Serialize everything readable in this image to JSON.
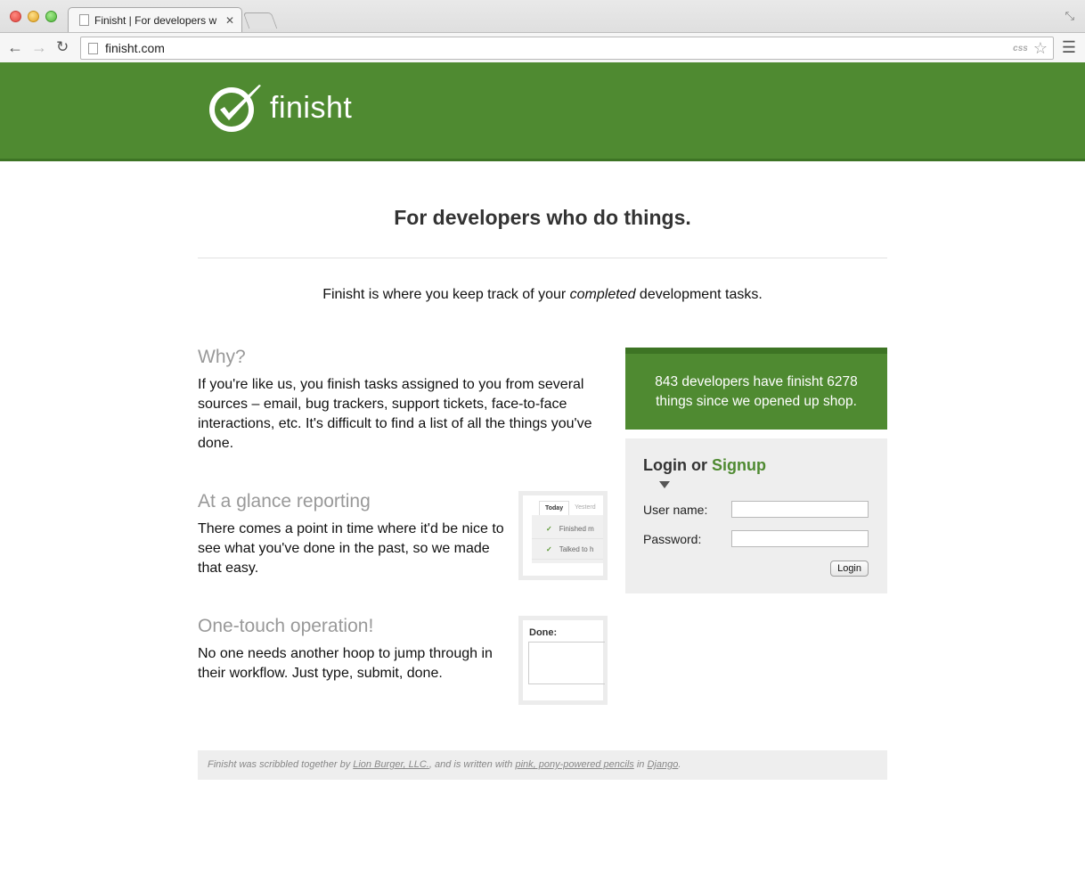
{
  "browser": {
    "tab_title": "Finisht | For developers w",
    "tab_close": "✕",
    "url": "finisht.com",
    "css_badge": "css",
    "icons": [
      "back-icon",
      "forward-icon",
      "reload-icon",
      "star-icon",
      "menu-icon",
      "fullscreen-icon"
    ]
  },
  "header": {
    "logo_text": "finisht",
    "brand_color": "#4f8a31"
  },
  "main": {
    "headline": "For developers who do things.",
    "tagline_before": "Finisht is where you keep track of your ",
    "tagline_em": "completed",
    "tagline_after": " development tasks."
  },
  "features": [
    {
      "title": "Why?",
      "text": "If you're like us, you finish tasks assigned to you from several sources – email, bug trackers, support tickets, face-to-face interactions, etc. It's difficult to find a list of all the things you've done."
    },
    {
      "title": "At a glance reporting",
      "text": "There comes a point in time where it'd be nice to see what you've done in the past, so we made that easy."
    },
    {
      "title": "One-touch operation!",
      "text": "No one needs another hoop to jump through in their workflow. Just type, submit, done."
    }
  ],
  "thumb_report": {
    "tab_today": "Today",
    "tab_yesterday": "Yesterd",
    "rows": [
      "Finished m",
      "Talked to h"
    ]
  },
  "thumb_done": {
    "label": "Done:"
  },
  "stats": {
    "text": "843 developers have finisht 6278 things since we opened up shop."
  },
  "login": {
    "title_login": "Login",
    "title_or": " or ",
    "title_signup": "Signup",
    "username_label": "User name:",
    "password_label": "Password:",
    "button": "Login"
  },
  "footer": {
    "text1": "Finisht was scribbled together by ",
    "link1": "Lion Burger, LLC.",
    "text2": ", and is written with ",
    "link2": "pink, pony-powered pencils",
    "text3": " in ",
    "link3": "Django",
    "text4": "."
  }
}
